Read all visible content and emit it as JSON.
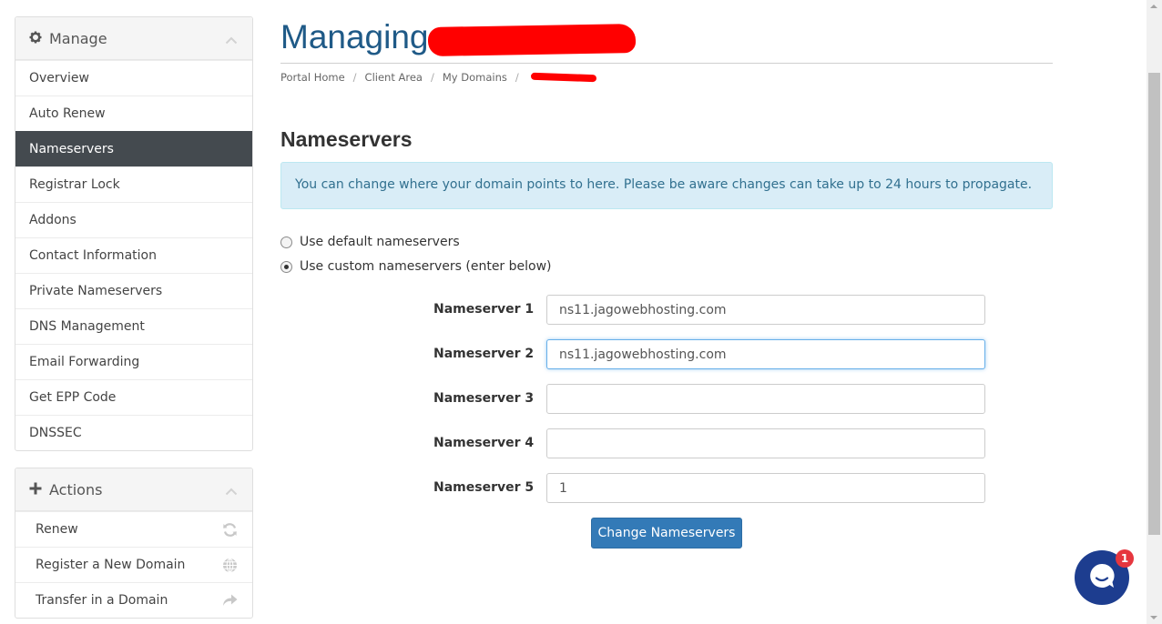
{
  "sidebar": {
    "manage": {
      "title": "Manage",
      "items": [
        {
          "label": "Overview"
        },
        {
          "label": "Auto Renew"
        },
        {
          "label": "Nameservers",
          "active": true
        },
        {
          "label": "Registrar Lock"
        },
        {
          "label": "Addons"
        },
        {
          "label": "Contact Information"
        },
        {
          "label": "Private Nameservers"
        },
        {
          "label": "DNS Management"
        },
        {
          "label": "Email Forwarding"
        },
        {
          "label": "Get EPP Code"
        },
        {
          "label": "DNSSEC"
        }
      ]
    },
    "actions": {
      "title": "Actions",
      "items": [
        {
          "label": "Renew",
          "icon": "refresh-icon"
        },
        {
          "label": "Register a New Domain",
          "icon": "globe-icon"
        },
        {
          "label": "Transfer in a Domain",
          "icon": "share-arrow-icon"
        }
      ]
    }
  },
  "header": {
    "title": "Managing"
  },
  "breadcrumb": [
    "Portal Home",
    "Client Area",
    "My Domains"
  ],
  "main": {
    "section_title": "Nameservers",
    "alert": "You can change where your domain points to here. Please be aware changes can take up to 24 hours to propagate.",
    "radio_default": "Use default nameservers",
    "radio_custom": "Use custom nameservers (enter below)",
    "nameservers": [
      {
        "label": "Nameserver 1",
        "value": "ns11.jagowebhosting.com"
      },
      {
        "label": "Nameserver 2",
        "value": "ns11.jagowebhosting.com"
      },
      {
        "label": "Nameserver 3",
        "value": ""
      },
      {
        "label": "Nameserver 4",
        "value": ""
      },
      {
        "label": "Nameserver 5",
        "value": "1"
      }
    ],
    "submit_label": "Change Nameservers"
  },
  "chat": {
    "badge_count": "1"
  },
  "colors": {
    "brand_title": "#1f5a87",
    "active_menu": "#444a4f",
    "primary_button": "#337ab7",
    "alert_bg": "#d9edf7",
    "chat_bg": "#1d3d8f",
    "badge": "#e6363e"
  }
}
